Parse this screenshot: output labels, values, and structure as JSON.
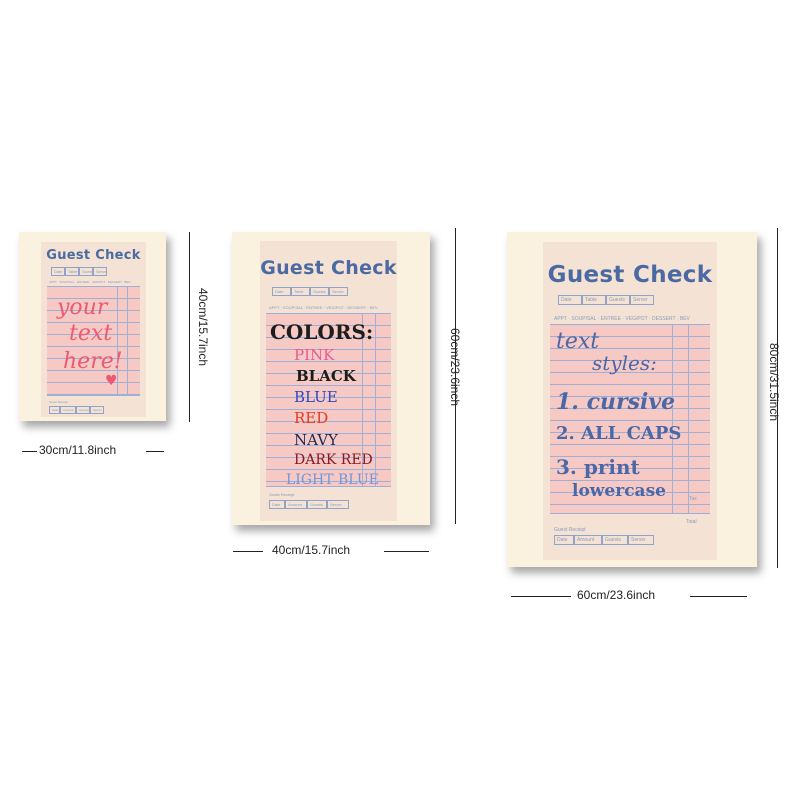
{
  "guest_check": {
    "title": "Guest Check",
    "header_labels": [
      "Date",
      "Table",
      "Guests",
      "Server"
    ],
    "course_line": "APPT · SOUP/SAL · ENTREE · VEG/POT · DESSERT · BEV",
    "footer_label": "Guest Receipt",
    "footer_labels": [
      "Date",
      "Amount",
      "Guests",
      "Server"
    ],
    "tax_label": "Tax",
    "total_label": "Total"
  },
  "products": [
    {
      "id": "small",
      "width_label": "30cm/11.8inch",
      "height_label": "40cm/15.7inch",
      "handwriting": {
        "lines": [
          "your",
          "text",
          "here!"
        ],
        "heart": "♥",
        "color": "#ec5a72"
      }
    },
    {
      "id": "medium",
      "width_label": "40cm/15.7inch",
      "height_label": "60cm/23.6inch",
      "handwriting": {
        "heading": "COLORS:",
        "heading_color": "#1d1d1d",
        "items": [
          {
            "text": "PINK",
            "color": "#ec5a8c"
          },
          {
            "text": "BLACK",
            "color": "#1b1b1b"
          },
          {
            "text": "BLUE",
            "color": "#2c48c0"
          },
          {
            "text": "RED",
            "color": "#e83a1f"
          },
          {
            "text": "NAVY",
            "color": "#1f2a55"
          },
          {
            "text": "DARK RED",
            "color": "#8a1722"
          },
          {
            "text": "LIGHT BLUE",
            "color": "#6f97dd"
          }
        ]
      }
    },
    {
      "id": "large",
      "width_label": "60cm/23.6inch",
      "height_label": "80cm/31.5inch",
      "handwriting": {
        "color": "#4a68a8",
        "lines": [
          "text",
          "styles:",
          "1. cursive",
          "2. ALL CAPS",
          "3. print",
          "lowercase"
        ]
      }
    }
  ]
}
